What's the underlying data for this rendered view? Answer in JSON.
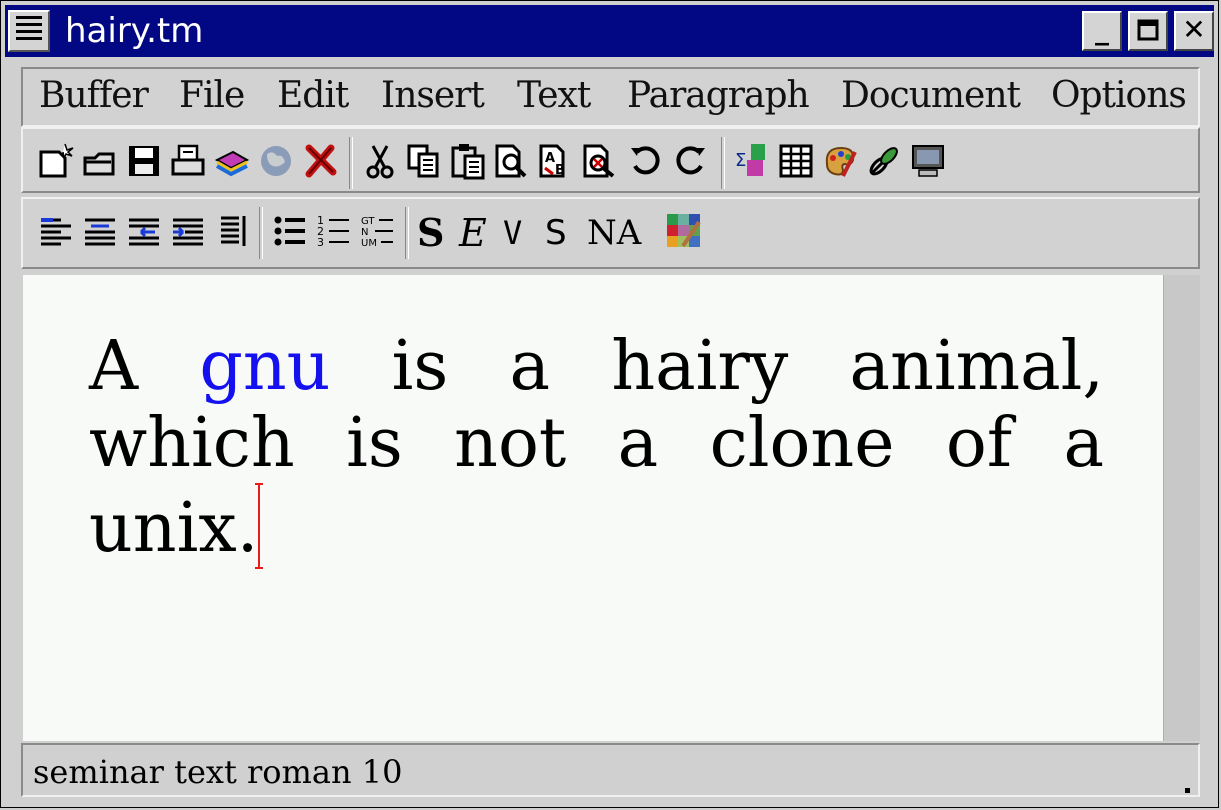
{
  "window": {
    "title": "hairy.tm"
  },
  "menubar": {
    "items": [
      "Buffer",
      "File",
      "Edit",
      "Insert",
      "Text",
      "Paragraph",
      "Document",
      "Options"
    ]
  },
  "toolbar1": {
    "icons": [
      "new-document-icon",
      "open-folder-icon",
      "save-icon",
      "print-icon",
      "books-icon",
      "globe-icon",
      "close-x-icon",
      "cut-icon",
      "copy-icon",
      "paste-icon",
      "find-icon",
      "replace-icon",
      "spell-check-icon",
      "undo-icon",
      "redo-icon",
      "insert-math-icon",
      "table-icon",
      "image-palette-icon",
      "link-icon",
      "session-computer-icon"
    ]
  },
  "toolbar2": {
    "icons": [
      "align-left-icon",
      "align-center-icon",
      "align-right-icon",
      "justify-icon",
      "align-full-icon",
      "bullet-list-icon",
      "numbered-list-icon",
      "description-list-icon"
    ],
    "text_buttons": [
      "S",
      "E",
      "V",
      "S",
      "NA"
    ],
    "color_icon": "color-picker-icon"
  },
  "document": {
    "lines": [
      [
        "A",
        "gnu",
        "is",
        "a",
        "hairy",
        "animal,"
      ],
      [
        "which",
        "is",
        "not",
        "a",
        "clone",
        "of",
        "a"
      ],
      [
        "unix."
      ]
    ],
    "highlight_word": "gnu",
    "highlight_color": "#1410ee",
    "cursor_color": "#ea1b1b"
  },
  "status": {
    "text": "seminar text roman 10",
    "right": "."
  }
}
